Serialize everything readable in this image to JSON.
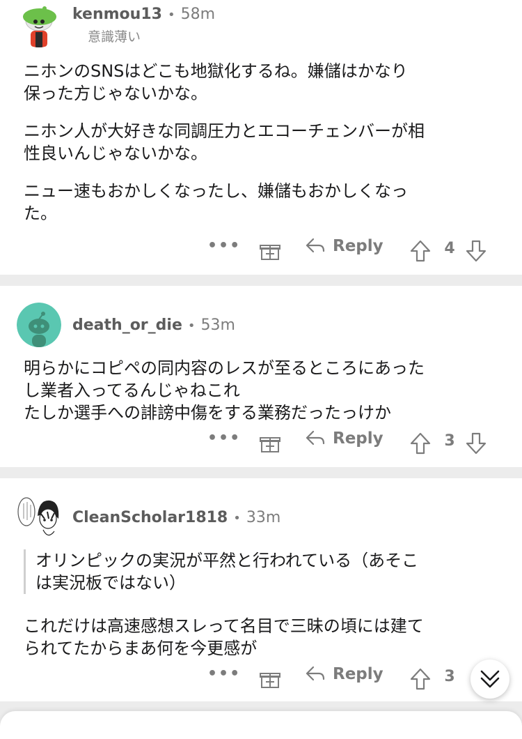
{
  "comments": [
    {
      "username": "kenmou13",
      "time": "58m",
      "flair": "意識薄い",
      "paragraphs": [
        "ニホンのSNSはどこも地獄化するね。嫌儲はかなり\n保った方じゃないかな。",
        "ニホン人が大好きな同調圧力とエコーチェンバーが相\n性良いんじゃないかな。",
        "ニュー速もおかしくなったし、嫌儲もおかしくなっ\nた。"
      ],
      "reply_label": "Reply",
      "score": "4",
      "more_label": "•••",
      "icons": [
        "snoo-avatar-icon",
        "award-icon",
        "reply-arrow-icon",
        "upvote-icon",
        "downvote-icon"
      ]
    },
    {
      "username": "death_or_die",
      "time": "53m",
      "paragraphs": [
        "明らかにコピペの同内容のレスが至るところにあった\nし業者入ってるんじゃねこれ\nたしか選手への誹謗中傷をする業務だったっけか"
      ],
      "reply_label": "Reply",
      "score": "3",
      "more_label": "•••"
    },
    {
      "username": "CleanScholar1818",
      "time": "33m",
      "quote": "オリンピックの実況が平然と行われている（あそこ\nは実況板ではない）",
      "paragraphs": [
        "これだけは高速感想スレって名目で三昧の頃には建て\nられてたからまあ何を今更感が"
      ],
      "reply_label": "Reply",
      "score": "3",
      "more_label": "•••"
    }
  ],
  "ui": {
    "separator_dot": "•",
    "scroll_button_icon": "double-chevron-down-icon",
    "colors": {
      "text": "#1a1a1b",
      "meta": "#7c7c7c",
      "background": "#ececec",
      "avatar_teal": "#5ac7b1",
      "avatar_dark": "#3f8f78"
    }
  }
}
